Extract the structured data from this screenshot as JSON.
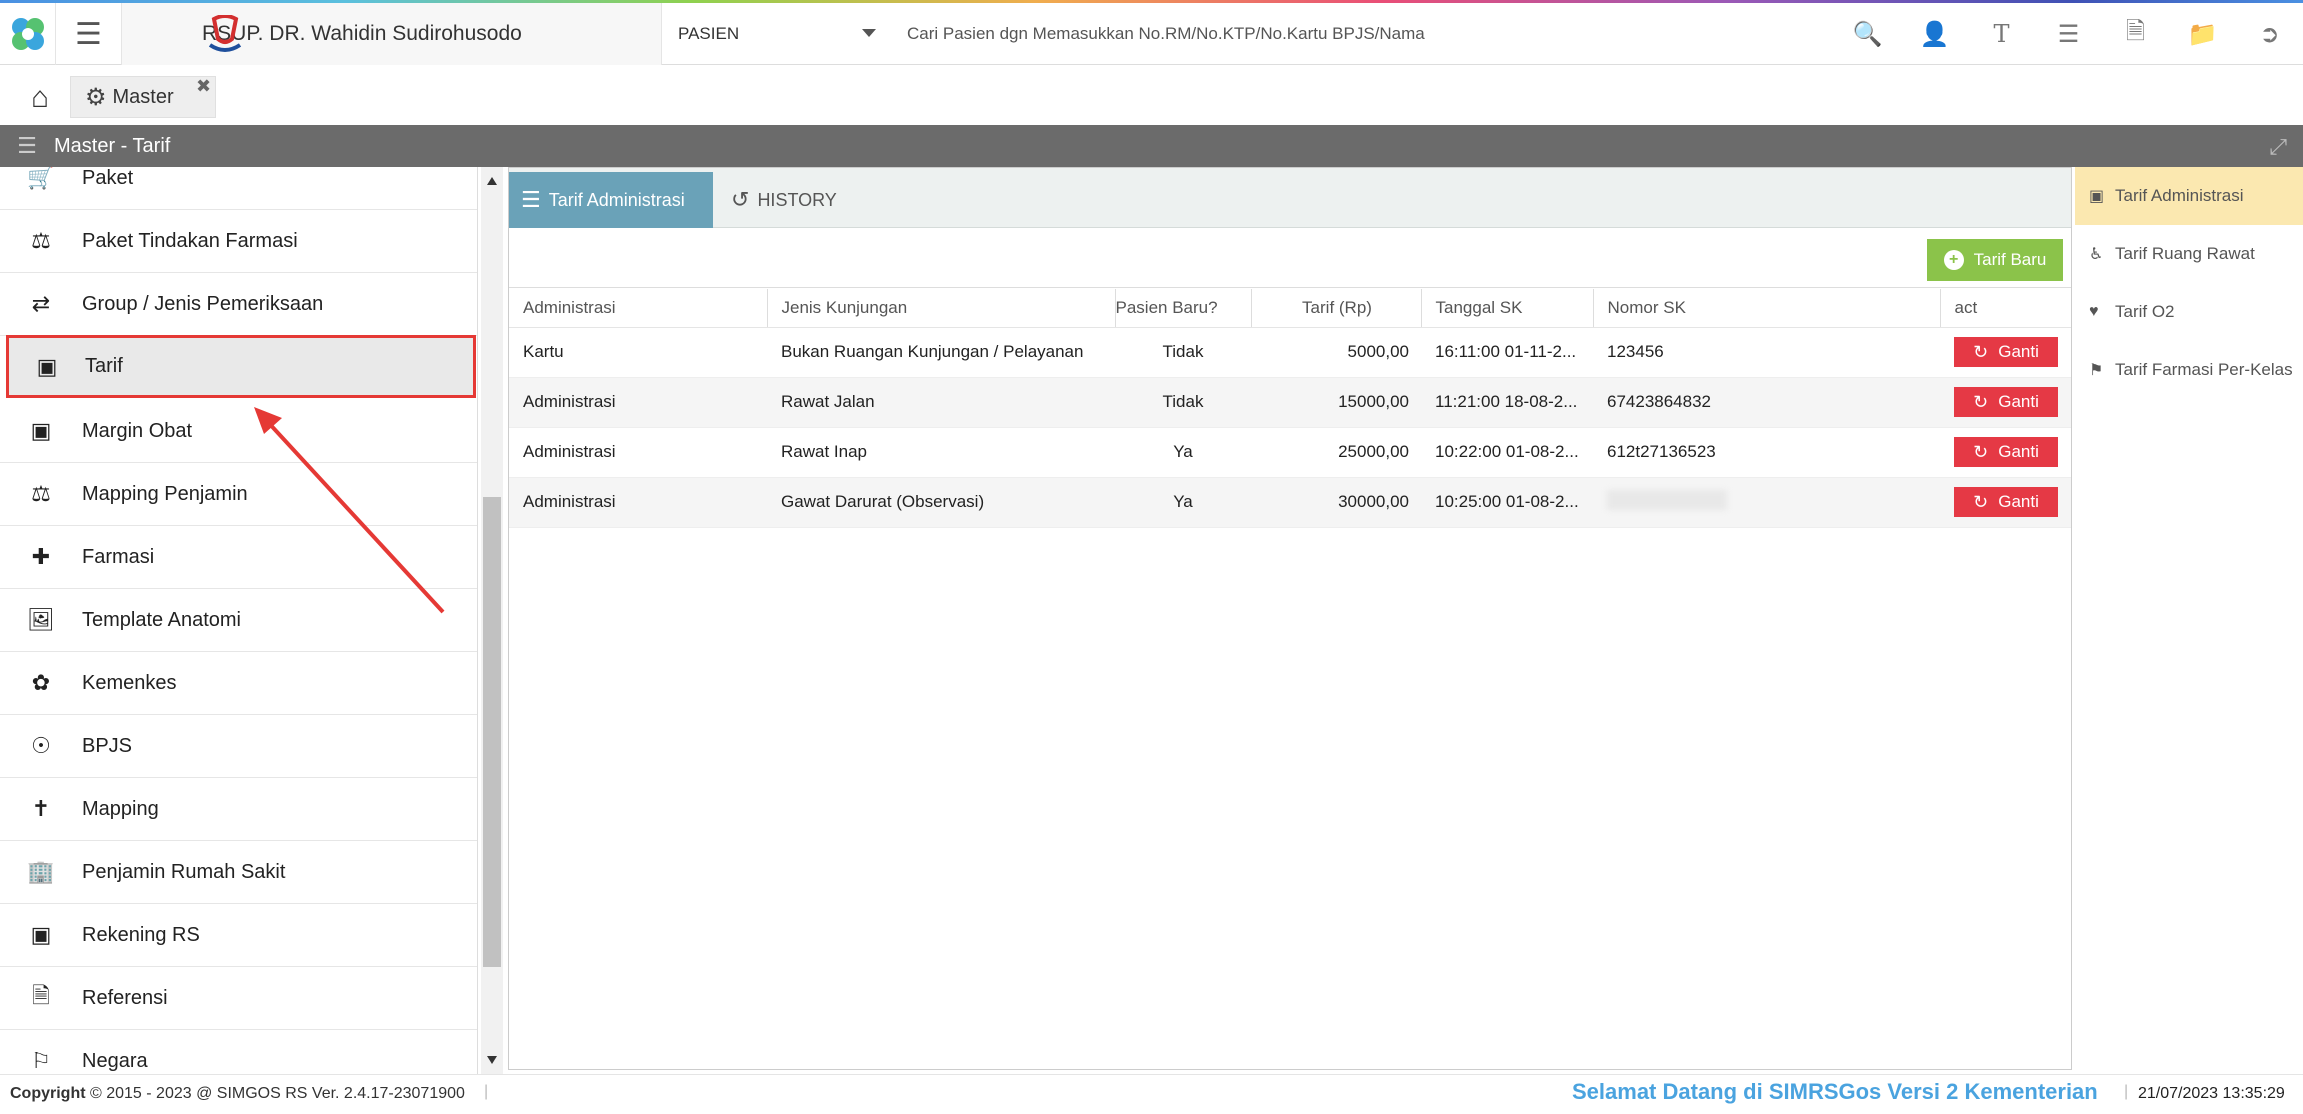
{
  "header": {
    "hospital_name": "RSUP. DR. Wahidin Sudirohusodo",
    "patient_select": "PASIEN",
    "search_placeholder": "Cari Pasien dgn Memasukkan No.RM/No.KTP/No.Kartu BPJS/Nama",
    "icons": [
      "search-icon",
      "add-user-icon",
      "text-icon",
      "list-icon",
      "pdf-icon",
      "folder-icon",
      "logout-icon"
    ]
  },
  "tabs": {
    "master_label": "Master"
  },
  "title_bar": {
    "title": "Master - Tarif"
  },
  "sidebar": {
    "items": [
      {
        "label": "Paket",
        "icon": "cart-icon"
      },
      {
        "label": "Paket Tindakan Farmasi",
        "icon": "flask-icon"
      },
      {
        "label": "Group / Jenis Pemeriksaan",
        "icon": "exchange-icon"
      },
      {
        "label": "Tarif",
        "icon": "money-icon"
      },
      {
        "label": "Margin Obat",
        "icon": "money-icon"
      },
      {
        "label": "Mapping Penjamin",
        "icon": "flask-icon"
      },
      {
        "label": "Farmasi",
        "icon": "medkit-icon"
      },
      {
        "label": "Template Anatomi",
        "icon": "image-file-icon"
      },
      {
        "label": "Kemenkes",
        "icon": "fan-icon"
      },
      {
        "label": "BPJS",
        "icon": "circle-dot-icon"
      },
      {
        "label": "Mapping",
        "icon": "signpost-icon"
      },
      {
        "label": "Penjamin Rumah Sakit",
        "icon": "building-icon"
      },
      {
        "label": "Rekening RS",
        "icon": "money-icon"
      },
      {
        "label": "Referensi",
        "icon": "document-icon"
      },
      {
        "label": "Negara",
        "icon": "flag-icon"
      }
    ],
    "active_index": 3
  },
  "main": {
    "tabs": [
      {
        "label": "Tarif Administrasi",
        "active": true
      },
      {
        "label": "HISTORY",
        "active": false
      }
    ],
    "new_button_label": "Tarif Baru",
    "columns": [
      "Administrasi",
      "Jenis Kunjungan",
      "Pasien Baru?",
      "Tarif (Rp)",
      "Tanggal SK",
      "Nomor SK",
      "act"
    ],
    "rows": [
      {
        "administrasi": "Kartu",
        "jenis": "Bukan Ruangan Kunjungan / Pelayanan",
        "pasien_baru": "Tidak",
        "tarif": "5000,00",
        "tanggal": "16:11:00 01-11-2...",
        "nomor": "123456",
        "action": "Ganti"
      },
      {
        "administrasi": "Administrasi",
        "jenis": "Rawat Jalan",
        "pasien_baru": "Tidak",
        "tarif": "15000,00",
        "tanggal": "11:21:00 18-08-2...",
        "nomor": "67423864832",
        "action": "Ganti"
      },
      {
        "administrasi": "Administrasi",
        "jenis": "Rawat Inap",
        "pasien_baru": "Ya",
        "tarif": "25000,00",
        "tanggal": "10:22:00 01-08-2...",
        "nomor": "612t27136523",
        "action": "Ganti"
      },
      {
        "administrasi": "Administrasi",
        "jenis": "Gawat Darurat (Observasi)",
        "pasien_baru": "Ya",
        "tarif": "30000,00",
        "tanggal": "10:25:00 01-08-2...",
        "nomor": "",
        "action": "Ganti"
      }
    ]
  },
  "right_nav": {
    "items": [
      {
        "label": "Tarif Administrasi",
        "icon": "money-icon",
        "active": true
      },
      {
        "label": "Tarif Ruang Rawat",
        "icon": "wheelchair-icon",
        "active": false
      },
      {
        "label": "Tarif O2",
        "icon": "heart-icon",
        "active": false
      },
      {
        "label": "Tarif Farmasi Per-Kelas",
        "icon": "tags-icon",
        "active": false
      }
    ]
  },
  "footer": {
    "copyright_label": "Copyright",
    "copyright_text": "2015 - 2023 @ SIMGOS RS Ver. 2.4.17-23071900",
    "marquee": "Selamat Datang di SIMRSGos Versi 2 Kementerian",
    "datetime": "21/07/2023 13:35:29"
  },
  "colors": {
    "active_tab": "#6aa2b8",
    "new_button": "#8bc34a",
    "ganti_button": "#e53945",
    "highlight_border": "#e53935",
    "right_nav_active": "#fbe8b0",
    "marquee_text": "#4aa3df"
  }
}
